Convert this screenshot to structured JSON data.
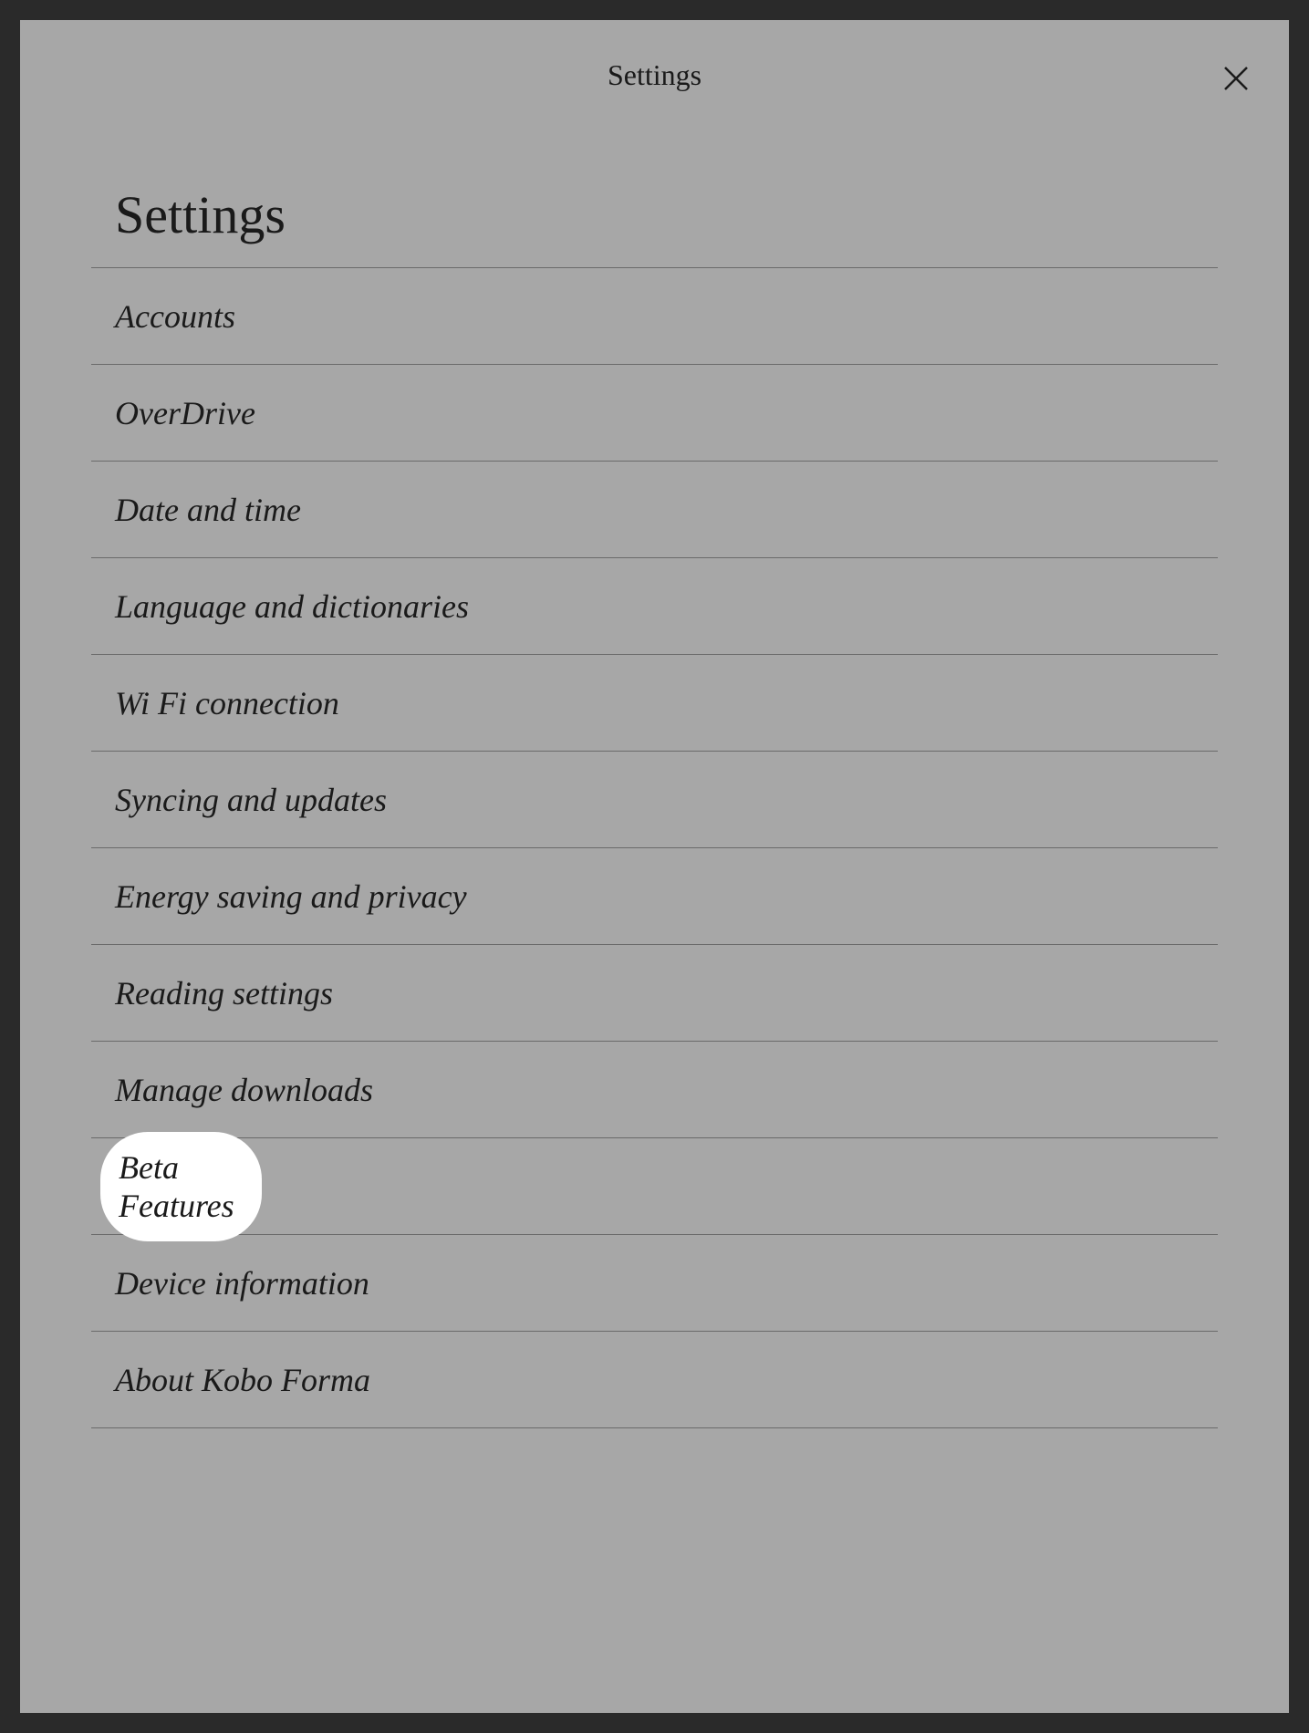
{
  "header": {
    "title": "Settings"
  },
  "page": {
    "title": "Settings"
  },
  "items": [
    {
      "label": "Accounts",
      "highlighted": false
    },
    {
      "label": "OverDrive",
      "highlighted": false
    },
    {
      "label": "Date and time",
      "highlighted": false
    },
    {
      "label": "Language and dictionaries",
      "highlighted": false
    },
    {
      "label": "Wi Fi connection",
      "highlighted": false
    },
    {
      "label": "Syncing and updates",
      "highlighted": false
    },
    {
      "label": "Energy saving and privacy",
      "highlighted": false
    },
    {
      "label": "Reading settings",
      "highlighted": false
    },
    {
      "label": "Manage downloads",
      "highlighted": false
    },
    {
      "label": "Beta Features",
      "highlighted": true
    },
    {
      "label": "Device information",
      "highlighted": false
    },
    {
      "label": "About Kobo Forma",
      "highlighted": false
    }
  ]
}
